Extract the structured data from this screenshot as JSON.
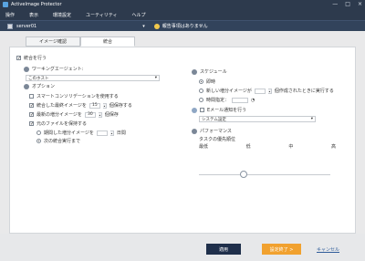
{
  "window": {
    "title": "ActiveImage Protector",
    "controls": [
      "—",
      "□",
      "×"
    ]
  },
  "menu": [
    "操作",
    "表示",
    "環境設定",
    "ユーティリティ",
    "ヘルプ"
  ],
  "server": {
    "name": "server01",
    "alert": "報告事項はありません"
  },
  "tabs": [
    "イメージ確認",
    "統合"
  ],
  "left": {
    "merge": "統合を行う",
    "workgroup": "ワーキングエージェント:",
    "workgroup_value": "このホスト",
    "options": "オプション",
    "smart": "スマートコンソリデーションを使用する",
    "keep_full": "統合した最終イメージを",
    "keep_full_value": "15",
    "keep_full_unit": "個保存する",
    "keep_latest": "最新の増分イメージを",
    "keep_latest_value": "30",
    "keep_latest_unit": "個保存",
    "keep_original": "元のファイルを保持する",
    "retention_days_label": "期間した増分イメージを",
    "retention_days_unit": "日間",
    "next_run_label": "次の統合実行まで"
  },
  "right": {
    "schedule": "スケジュール",
    "instant": "即時",
    "new_full": "新しい増分イメージが",
    "new_full_suffix": "個作成されたときに実行する",
    "time_spec": "時間指定：",
    "mail": "Eメール通知を行う",
    "mail_value": "システム設定",
    "performance": "パフォーマンス",
    "priority_label": "タスクの優先順位",
    "slider_labels": [
      "最低",
      "低",
      "中",
      "高"
    ]
  },
  "footer": {
    "apply": "適用",
    "finish": "設定終了 >",
    "cancel": "キャンセル"
  }
}
